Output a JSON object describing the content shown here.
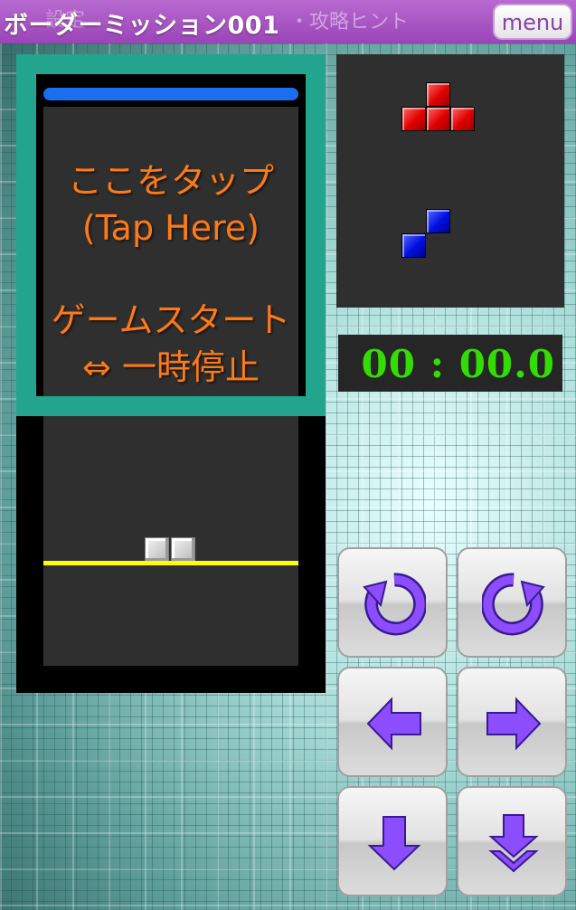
{
  "header": {
    "title": "ボーダーミッション001",
    "bg_text": "設定",
    "bg_hint": "・攻略ヒント",
    "menu_label": "menu"
  },
  "overlay": {
    "tap_jp": "ここをタップ",
    "tap_en": "(Tap Here)",
    "start": "ゲームスタート",
    "pause": "⇔ 一時停止"
  },
  "next_pieces": [
    {
      "shape": "T",
      "color": "#e00000"
    },
    {
      "shape": "S",
      "color": "#0010e0"
    }
  ],
  "timer": {
    "display": "00 : 00.0"
  },
  "controls": [
    {
      "icon": "rotate-left-icon"
    },
    {
      "icon": "rotate-right-icon"
    },
    {
      "icon": "arrow-left-icon"
    },
    {
      "icon": "arrow-right-icon"
    },
    {
      "icon": "arrow-down-icon"
    },
    {
      "icon": "hard-drop-icon"
    }
  ],
  "colors": {
    "accent_purple": "#8c4dff",
    "frame_teal": "#22a48e",
    "timer_green": "#33dd00",
    "tap_orange": "#ff7a12",
    "limit_yellow": "#ffff00"
  }
}
